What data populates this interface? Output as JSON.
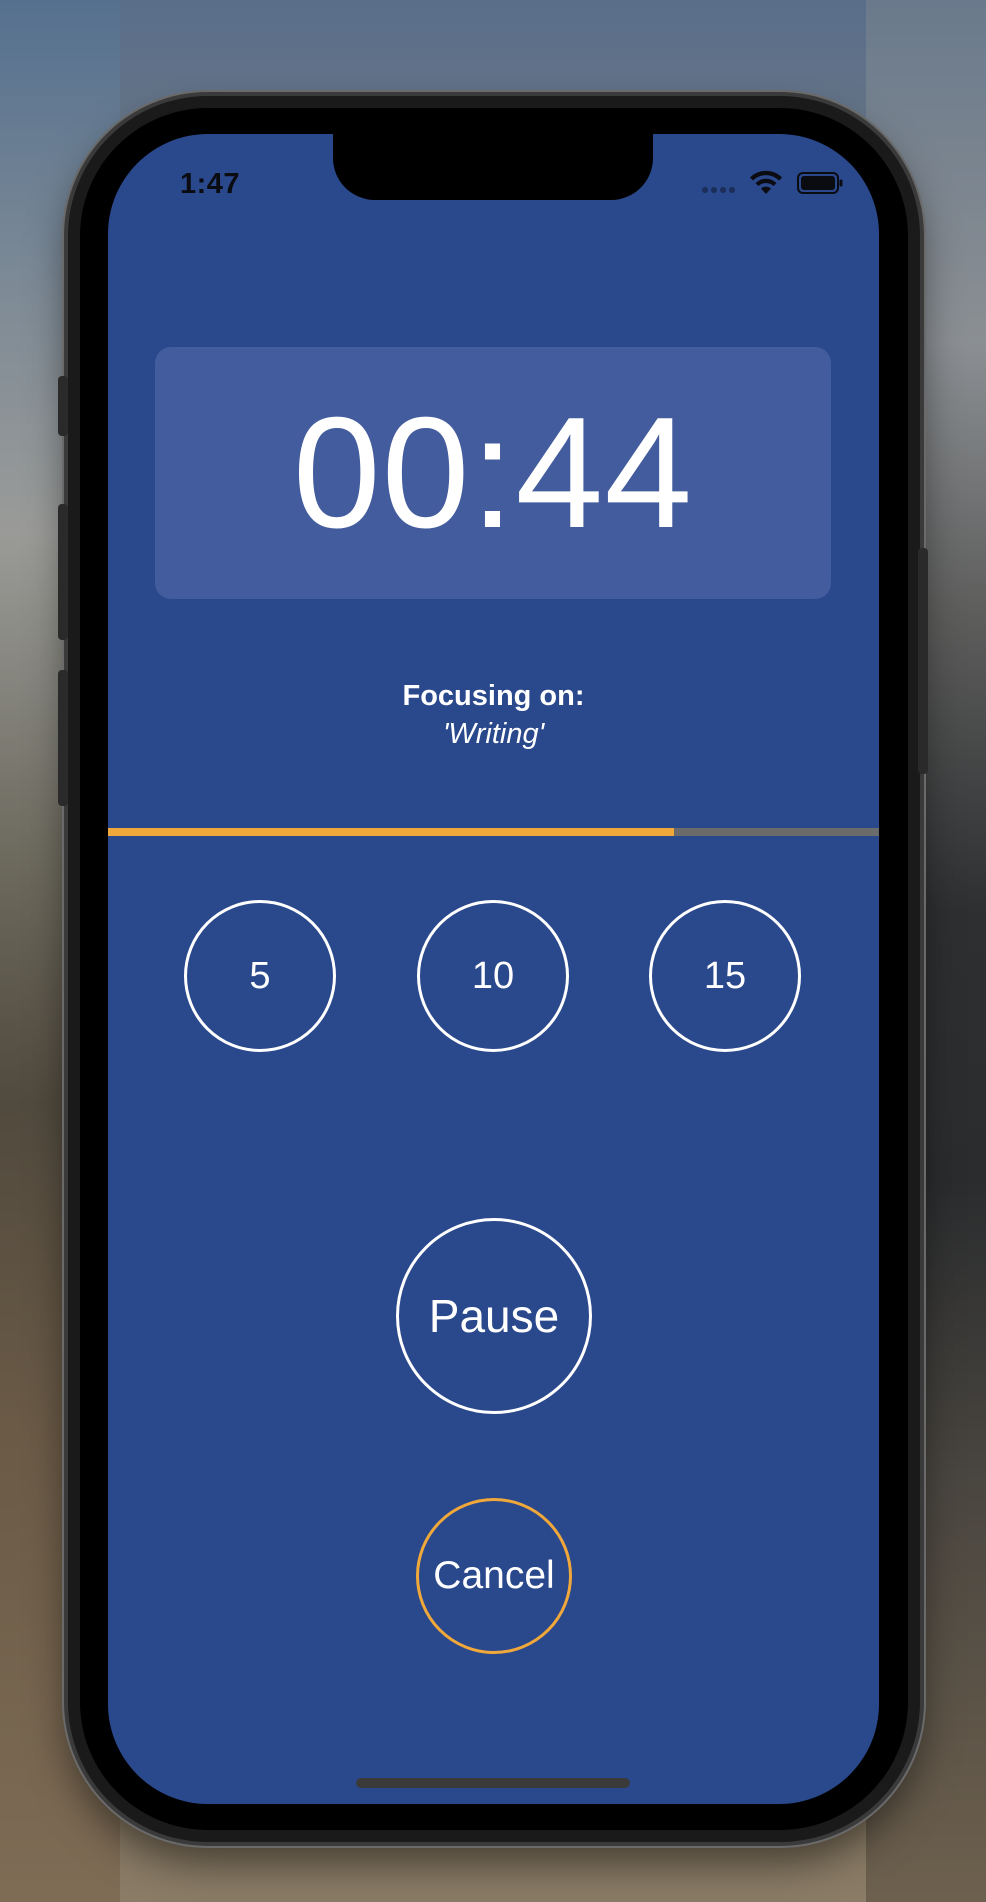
{
  "status_bar": {
    "time": "1:47",
    "icons": [
      "cellular-signal-icon",
      "wifi-icon",
      "battery-icon"
    ]
  },
  "timer": {
    "display": "00:44"
  },
  "focus": {
    "label": "Focusing on:",
    "task": "'Writing'"
  },
  "progress": {
    "fraction": 0.734
  },
  "presets": [
    "5",
    "10",
    "15"
  ],
  "actions": {
    "pause_label": "Pause",
    "cancel_label": "Cancel"
  },
  "colors": {
    "background": "#2a488c",
    "timer_panel": "#435c9d",
    "accent_orange": "#f1a83a",
    "progress_track": "#6b6b6b",
    "text": "#ffffff"
  }
}
